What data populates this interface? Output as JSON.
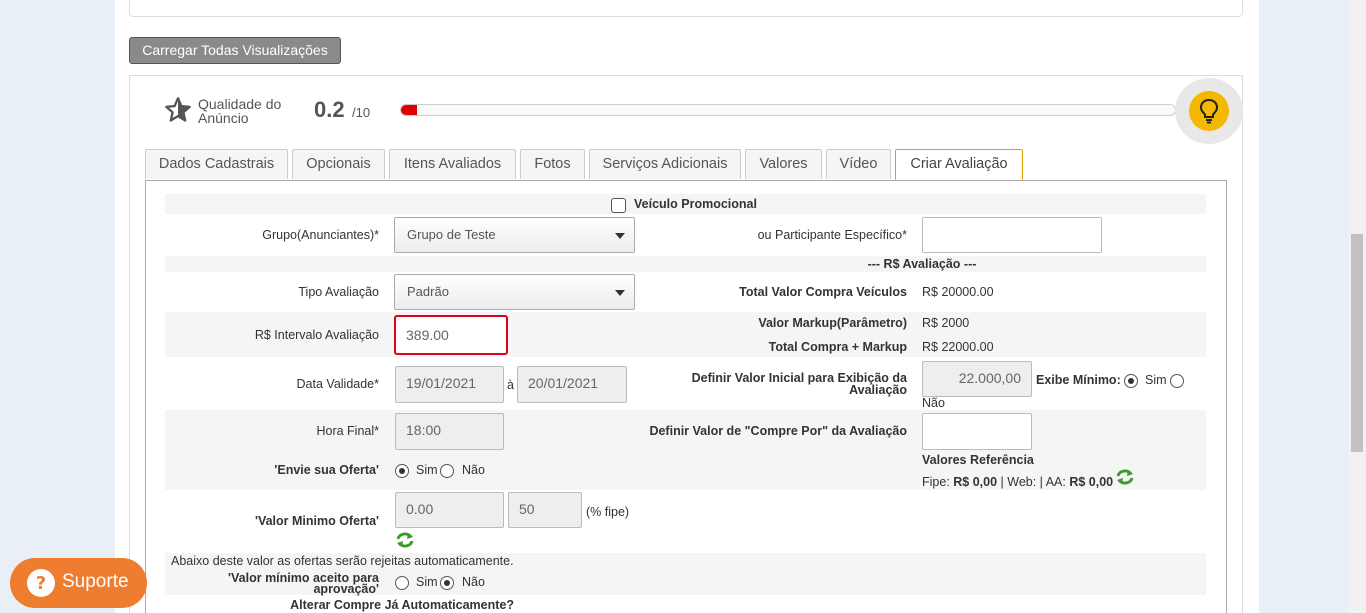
{
  "load_all_button": "Carregar Todas Visualizações",
  "quality": {
    "label": "Qualidade do Anúncio",
    "score": "0.2",
    "max": "/10",
    "progress_fraction": 0.02
  },
  "tabs": [
    {
      "label": "Dados Cadastrais"
    },
    {
      "label": "Opcionais"
    },
    {
      "label": "Itens Avaliados"
    },
    {
      "label": "Fotos"
    },
    {
      "label": "Serviços Adicionais"
    },
    {
      "label": "Valores"
    },
    {
      "label": "Vídeo"
    },
    {
      "label": "Criar Avaliação",
      "active": true
    }
  ],
  "form": {
    "promo_label": "Veículo Promocional",
    "group_label": "Grupo(Anunciantes)*",
    "group_value": "Grupo de Teste",
    "participant_label": "ou Participante Específico*",
    "participant_value": "",
    "section_title": "--- R$ Avaliação ---",
    "type_label": "Tipo Avaliação",
    "type_value": "Padrão",
    "total_purchase_label": "Total Valor Compra Veículos",
    "total_purchase_value": "R$ 20000.00",
    "interval_label": "R$ Intervalo Avaliação",
    "interval_value": "389.00",
    "markup_label": "Valor Markup(Parâmetro)",
    "markup_value": "R$ 2000",
    "total_markup_label": "Total Compra + Markup",
    "total_markup_value": "R$ 22000.00",
    "validity_label": "Data Validade*",
    "validity_from": "19/01/2021",
    "validity_sep": "à",
    "validity_to": "20/01/2021",
    "initial_value_label_1": "Definir Valor Inicial para Exibição da",
    "initial_value_label_2": "Avaliação",
    "initial_value": "22.000,00",
    "show_min_label": "Exibe Mínimo:",
    "yes": "Sim",
    "no": "Não",
    "final_hour_label": "Hora Final*",
    "final_hour_value": "18:00",
    "buy_for_label": "Definir Valor de \"Compre Por\" da Avaliação",
    "buy_for_value": "",
    "send_offer_label": "'Envie sua Oferta'",
    "ref_values_label": "Valores Referência",
    "ref_fipe_label": "Fipe:",
    "ref_fipe_value": "R$ 0,00",
    "ref_web": " | Web: | AA:",
    "ref_aa_value": "R$ 0,00",
    "min_offer_label": "'Valor Minimo Oferta'",
    "min_offer_value": "0.00",
    "min_offer_pct": "50",
    "min_offer_pct_label": "(% fipe)",
    "reject_note": "Abaixo deste valor as ofertas serão rejeitas automaticamente.",
    "min_accept_label_1": "'Valor mínimo aceito para",
    "min_accept_label_2": "aprovação'",
    "auto_buy_label": "Alterar Compre Já Automaticamente?"
  },
  "support_button": "Suporte",
  "colors": {
    "progress": "#e00000",
    "bulb": "#f5b800",
    "support": "#ef7d2f",
    "interval_highlight": "#e0001a",
    "active_tab_border": "#e0a000",
    "refresh_icon": "#3a9a2a"
  }
}
